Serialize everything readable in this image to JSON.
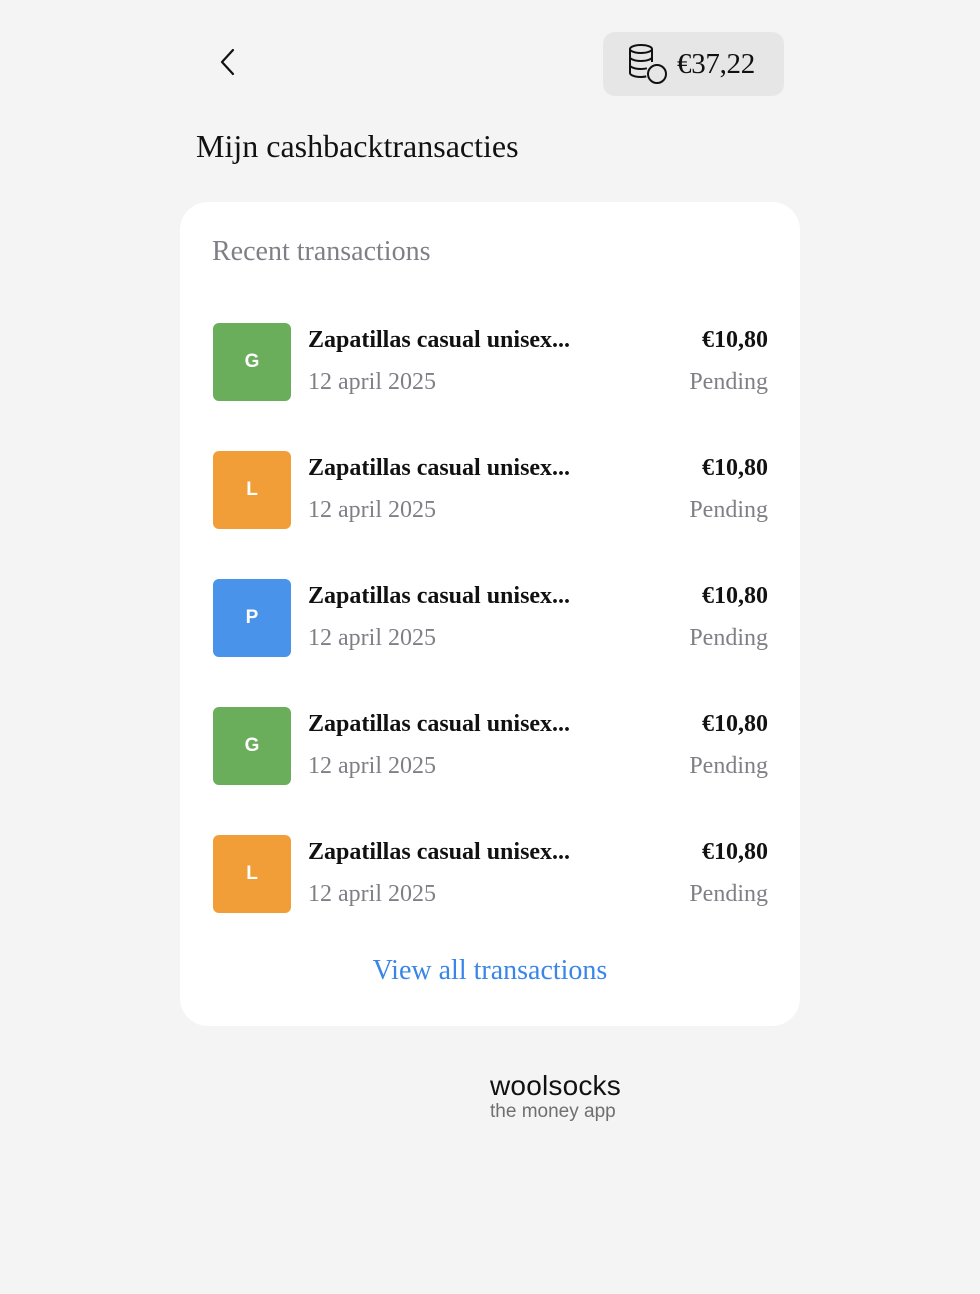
{
  "header": {
    "back_icon": "chevron-left-icon",
    "balance": {
      "icon": "coins-icon",
      "amount": "€37,22"
    }
  },
  "page_title": "Mijn cashbacktransacties",
  "recent": {
    "label": "Recent transactions",
    "transactions": [
      {
        "initial": "G",
        "color": "#6aad5b",
        "name": "Zapatillas casual unisex...",
        "date": "12 april 2025",
        "amount": "€10,80",
        "status": "Pending"
      },
      {
        "initial": "L",
        "color": "#f29e38",
        "name": "Zapatillas casual unisex...",
        "date": "12 april 2025",
        "amount": "€10,80",
        "status": "Pending"
      },
      {
        "initial": "P",
        "color": "#4a93eb",
        "name": "Zapatillas casual unisex...",
        "date": "12 april 2025",
        "amount": "€10,80",
        "status": "Pending"
      },
      {
        "initial": "G",
        "color": "#6aad5b",
        "name": "Zapatillas casual unisex...",
        "date": "12 april 2025",
        "amount": "€10,80",
        "status": "Pending"
      },
      {
        "initial": "L",
        "color": "#f29e38",
        "name": "Zapatillas casual unisex...",
        "date": "12 april 2025",
        "amount": "€10,80",
        "status": "Pending"
      }
    ],
    "view_all_label": "View all transactions"
  },
  "brand": {
    "name": "woolsocks",
    "tagline": "the money app"
  },
  "colors": {
    "background": "#f4f4f4",
    "card": "#ffffff",
    "link": "#3a86e8",
    "muted_text": "#7f7f86",
    "pill": "#e6e6e6"
  }
}
